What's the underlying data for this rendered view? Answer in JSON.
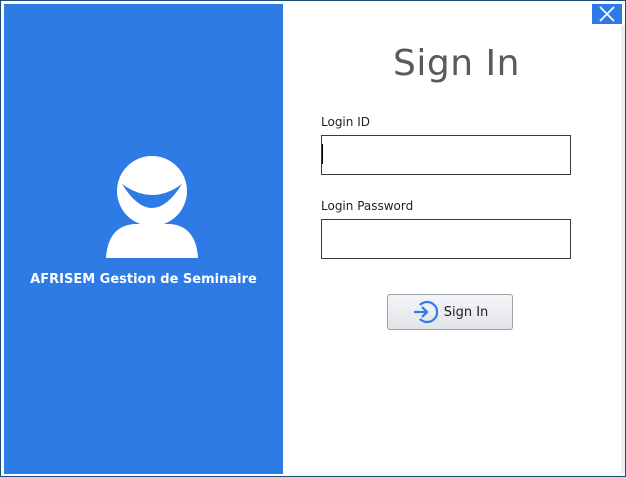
{
  "brand": {
    "title": "AFRISEM Gestion de Seminaire",
    "color": "#2E7BE6"
  },
  "window": {
    "close_icon": "close-icon"
  },
  "form": {
    "heading": "Sign In",
    "login_id_label": "Login ID",
    "login_id_value": "",
    "login_password_label": "Login Password",
    "login_password_value": "",
    "submit_label": "Sign In",
    "submit_icon": "sign-in-arrow-icon"
  }
}
